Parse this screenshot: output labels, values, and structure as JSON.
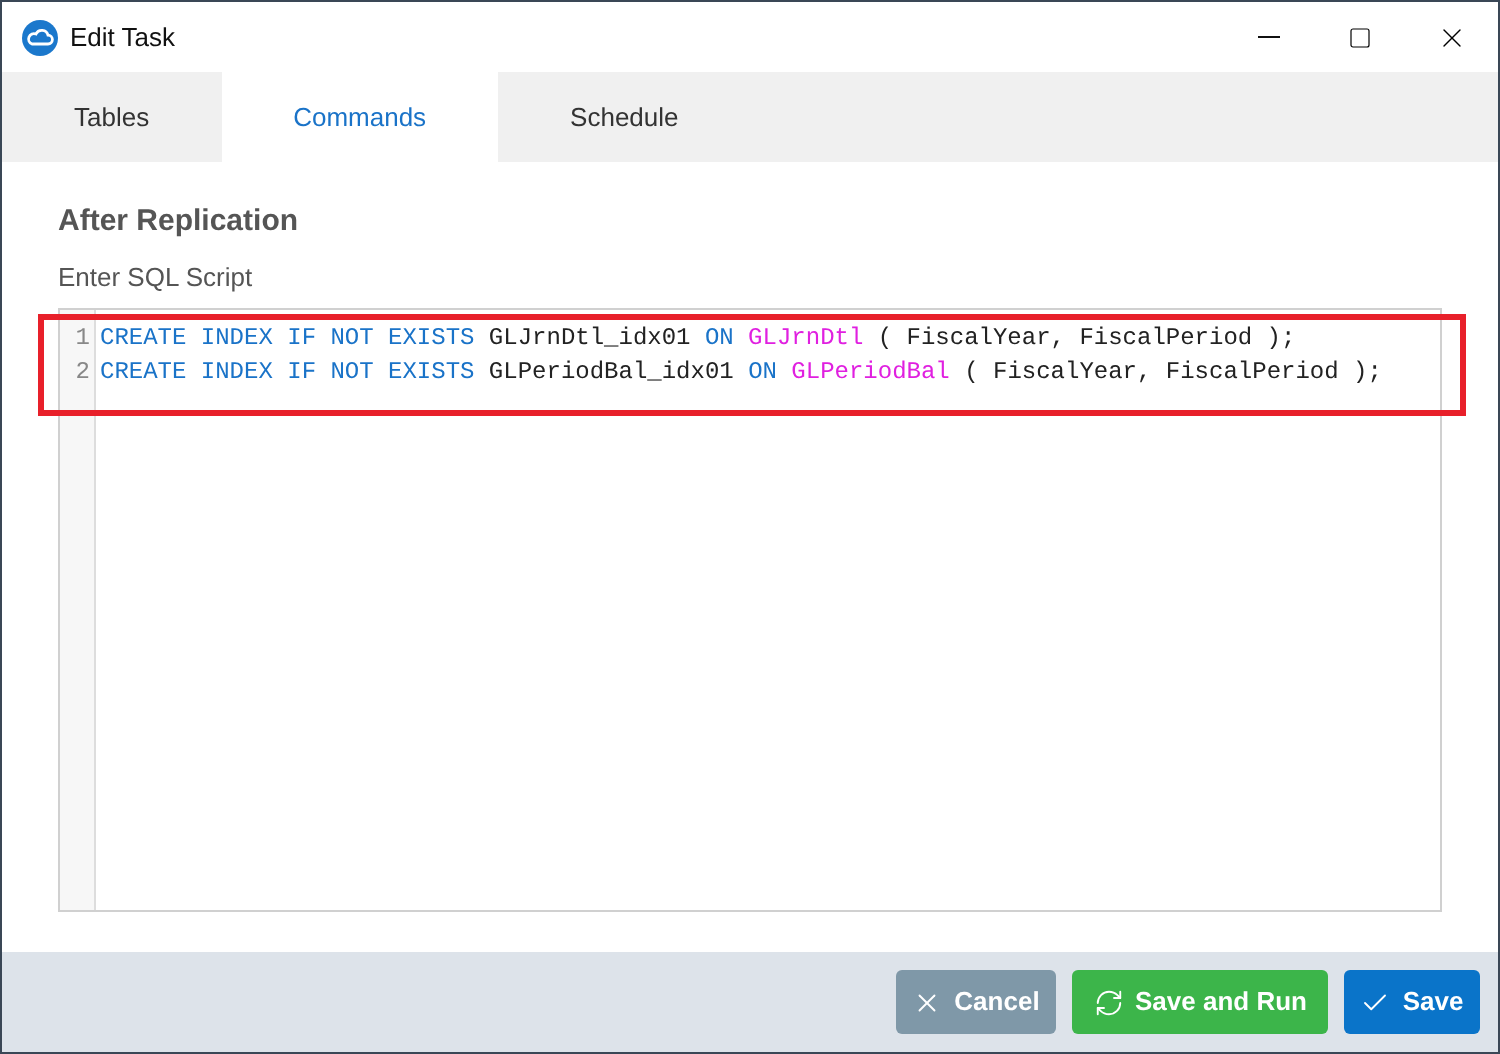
{
  "window": {
    "title": "Edit Task"
  },
  "tabs": [
    {
      "label": "Tables",
      "selected": false
    },
    {
      "label": "Commands",
      "selected": true
    },
    {
      "label": "Schedule",
      "selected": false
    }
  ],
  "section": {
    "title": "After Replication",
    "field_label": "Enter SQL Script"
  },
  "editor": {
    "highlighted": true,
    "lines": [
      {
        "number": "1",
        "tokens": [
          {
            "kind": "keyword",
            "text": "CREATE INDEX IF NOT EXISTS"
          },
          {
            "kind": "plain",
            "text": " GLJrnDtl_idx01 "
          },
          {
            "kind": "keyword",
            "text": "ON"
          },
          {
            "kind": "table",
            "text": " GLJrnDtl"
          },
          {
            "kind": "plain",
            "text": " ( FiscalYear, FiscalPeriod );"
          }
        ]
      },
      {
        "number": "2",
        "tokens": [
          {
            "kind": "keyword",
            "text": "CREATE INDEX IF NOT EXISTS"
          },
          {
            "kind": "plain",
            "text": " GLPeriodBal_idx01 "
          },
          {
            "kind": "keyword",
            "text": "ON"
          },
          {
            "kind": "table",
            "text": " GLPeriodBal"
          },
          {
            "kind": "plain",
            "text": " ( FiscalYear, FiscalPeriod );"
          }
        ]
      }
    ]
  },
  "buttons": [
    {
      "kind": "cancel",
      "label": "Cancel"
    },
    {
      "kind": "run",
      "label": "Save and Run"
    },
    {
      "kind": "save",
      "label": "Save"
    }
  ]
}
